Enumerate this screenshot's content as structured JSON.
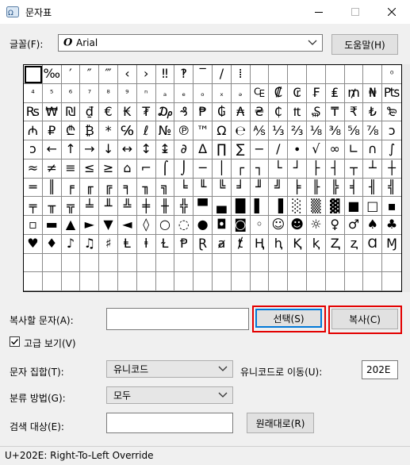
{
  "window": {
    "title": "문자표"
  },
  "font": {
    "label": "글꼴(F):",
    "value": "Arial",
    "help_button": "도움말(H)"
  },
  "grid": {
    "rows": [
      [
        "",
        "‰",
        "′",
        "″",
        "‴",
        "‹",
        "›",
        "‼",
        "‽",
        "‾",
        "/",
        "⁞",
        "",
        "",
        "",
        "",
        "",
        "",
        "",
        "⁰"
      ],
      [
        "⁴",
        "⁵",
        "⁶",
        "⁷",
        "⁸",
        "⁹",
        "ⁿ",
        "ₐ",
        "ₑ",
        "ₒ",
        "ₓ",
        "ₔ",
        "₠",
        "₡",
        "₢",
        "₣",
        "₤",
        "₥",
        "₦",
        "₧"
      ],
      [
        "₨",
        "₩",
        "₪",
        "₫",
        "€",
        "₭",
        "₮",
        "₯",
        "₰",
        "₱",
        "₲",
        "₳",
        "₴",
        "₵",
        "₶",
        "₷",
        "₸",
        "₹",
        "₺",
        "₻"
      ],
      [
        "₼",
        "₽",
        "₾",
        "₿",
        "*",
        "℅",
        "ℓ",
        "№",
        "℗",
        "™",
        "Ω",
        "℮",
        "⅍",
        "⅓",
        "⅔",
        "⅛",
        "⅜",
        "⅝",
        "⅞",
        "ↄ"
      ],
      [
        "ↄ",
        "←",
        "↑",
        "→",
        "↓",
        "↔",
        "↕",
        "↨",
        "∂",
        "∆",
        "∏",
        "∑",
        "−",
        "∕",
        "∙",
        "√",
        "∞",
        "∟",
        "∩",
        "∫"
      ],
      [
        "≈",
        "≠",
        "≡",
        "≤",
        "≥",
        "⌂",
        "⌐",
        "⌠",
        "⌡",
        "─",
        "│",
        "┌",
        "┐",
        "└",
        "┘",
        "├",
        "┤",
        "┬",
        "┴",
        "┼"
      ],
      [
        "═",
        "║",
        "╒",
        "╓",
        "╔",
        "╕",
        "╖",
        "╗",
        "╘",
        "╙",
        "╚",
        "╛",
        "╜",
        "╝",
        "╞",
        "╟",
        "╠",
        "╡",
        "╢",
        "╣"
      ],
      [
        "╤",
        "╥",
        "╦",
        "╧",
        "╨",
        "╩",
        "╪",
        "╫",
        "╬",
        "▀",
        "▄",
        "█",
        "▌",
        "▐",
        "░",
        "▒",
        "▓",
        "■",
        "□",
        "▪"
      ],
      [
        "▫",
        "▬",
        "▲",
        "►",
        "▼",
        "◄",
        "◊",
        "○",
        "◌",
        "●",
        "◘",
        "◙",
        "◦",
        "☺",
        "☻",
        "☼",
        "♀",
        "♂",
        "♠",
        "♣"
      ],
      [
        "♥",
        "♦",
        "♪",
        "♫",
        "♯",
        "Ⱡ",
        "ⱡ",
        "Ɫ",
        "Ᵽ",
        "Ɽ",
        "ⱥ",
        "ⱦ",
        "Ⱨ",
        "ⱨ",
        "Ⱪ",
        "ⱪ",
        "Ⱬ",
        "ⱬ",
        "Ɑ",
        "Ɱ"
      ],
      [
        "",
        "",
        "",
        "",
        "",
        "",
        "",
        "",
        "",
        "",
        "",
        "",
        "",
        "",
        "",
        "",
        "",
        "",
        "",
        ""
      ],
      [
        "",
        "",
        "",
        "",
        "",
        "",
        "",
        "",
        "",
        "",
        "",
        "",
        "",
        "",
        "",
        "",
        "",
        "",
        "",
        ""
      ]
    ]
  },
  "copy": {
    "label": "복사할 문자(A):",
    "value": "",
    "select_button": "선택(S)",
    "copy_button": "복사(C)"
  },
  "advanced": {
    "label": "고급 보기(V)",
    "checked": true
  },
  "charset": {
    "label": "문자 집합(T):",
    "value": "유니코드"
  },
  "goto_unicode": {
    "label": "유니코드로 이동(U):",
    "value": "202E"
  },
  "group_by": {
    "label": "분류 방법(G):",
    "value": "모두"
  },
  "search": {
    "label": "검색 대상(E):",
    "value": "",
    "button": "원래대로(R)"
  },
  "status_bar": {
    "text": "U+202E: Right-To-Left Override"
  },
  "colors": {
    "highlight": "#e30000",
    "focus": "#0078d7"
  },
  "icons": [
    "charmap-app-icon",
    "minimize-icon",
    "maximize-icon",
    "close-icon",
    "font-o-icon",
    "chevron-down-icon",
    "checkmark-icon"
  ]
}
